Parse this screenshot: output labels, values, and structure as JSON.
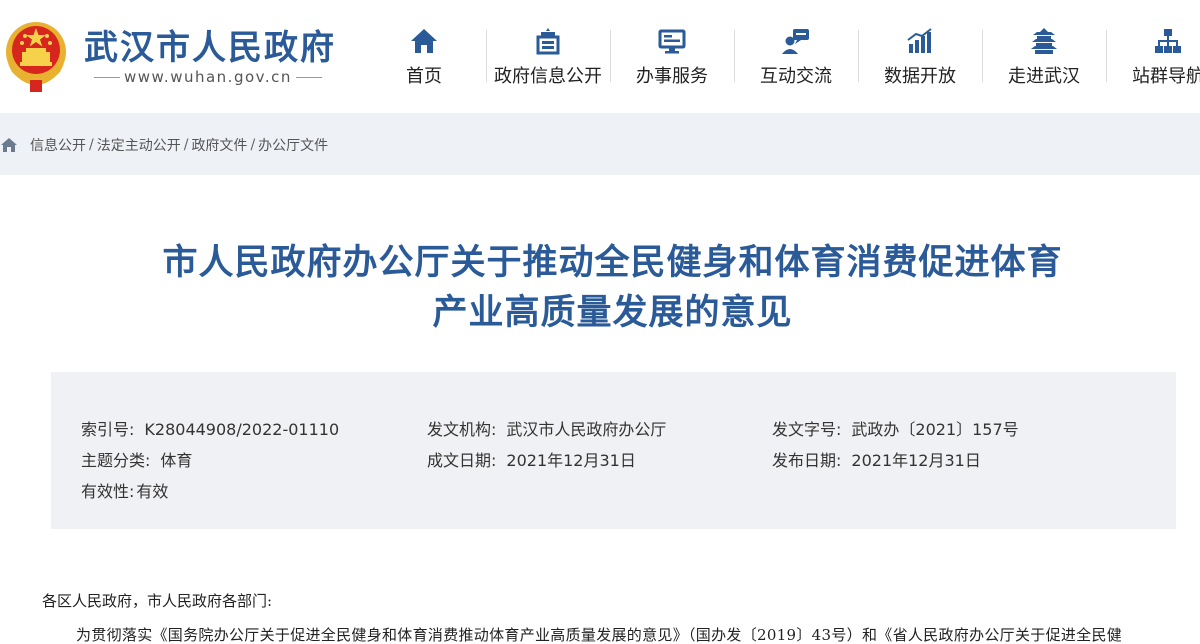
{
  "header": {
    "site_name": "武汉市人民政府",
    "site_url": "www.wuhan.gov.cn"
  },
  "nav": {
    "items": [
      {
        "label": "首页",
        "icon": "home-icon"
      },
      {
        "label": "政府信息公开",
        "icon": "building-icon"
      },
      {
        "label": "办事服务",
        "icon": "monitor-icon"
      },
      {
        "label": "互动交流",
        "icon": "chat-user-icon"
      },
      {
        "label": "数据开放",
        "icon": "bar-chart-icon"
      },
      {
        "label": "走进武汉",
        "icon": "pavilion-icon"
      },
      {
        "label": "站群导航",
        "icon": "sitemap-icon"
      }
    ]
  },
  "breadcrumb": {
    "items": [
      "信息公开",
      "法定主动公开",
      "政府文件",
      "办公厅文件"
    ]
  },
  "article": {
    "title_line1": "市人民政府办公厅关于推动全民健身和体育消费促进体育",
    "title_line2": "产业高质量发展的意见"
  },
  "meta": {
    "index_no_label": "索引号:",
    "index_no": "K28044908/2022-01110",
    "issuer_label": "发文机构:",
    "issuer": "武汉市人民政府办公厅",
    "doc_no_label": "发文字号:",
    "doc_no": "武政办〔2021〕157号",
    "topic_label": "主题分类:",
    "topic": "体育",
    "created_label": "成文日期:",
    "created": "2021年12月31日",
    "published_label": "发布日期:",
    "published": "2021年12月31日",
    "validity_label": "有效性:",
    "validity": "有效"
  },
  "body": {
    "salutation": "各区人民政府，市人民政府各部门:",
    "para1": "为贯彻落实《国务院办公厅关于促进全民健身和体育消费推动体育产业高质量发展的意见》（国办发〔2019〕43号）和《省人民政府办公厅关于促进全民健"
  },
  "colors": {
    "brand_blue": "#2a5a98",
    "crumb_bg": "#eef2f7",
    "meta_bg": "#f0f1f4",
    "emblem_red": "#d7261e",
    "emblem_gold": "#e8b230"
  }
}
